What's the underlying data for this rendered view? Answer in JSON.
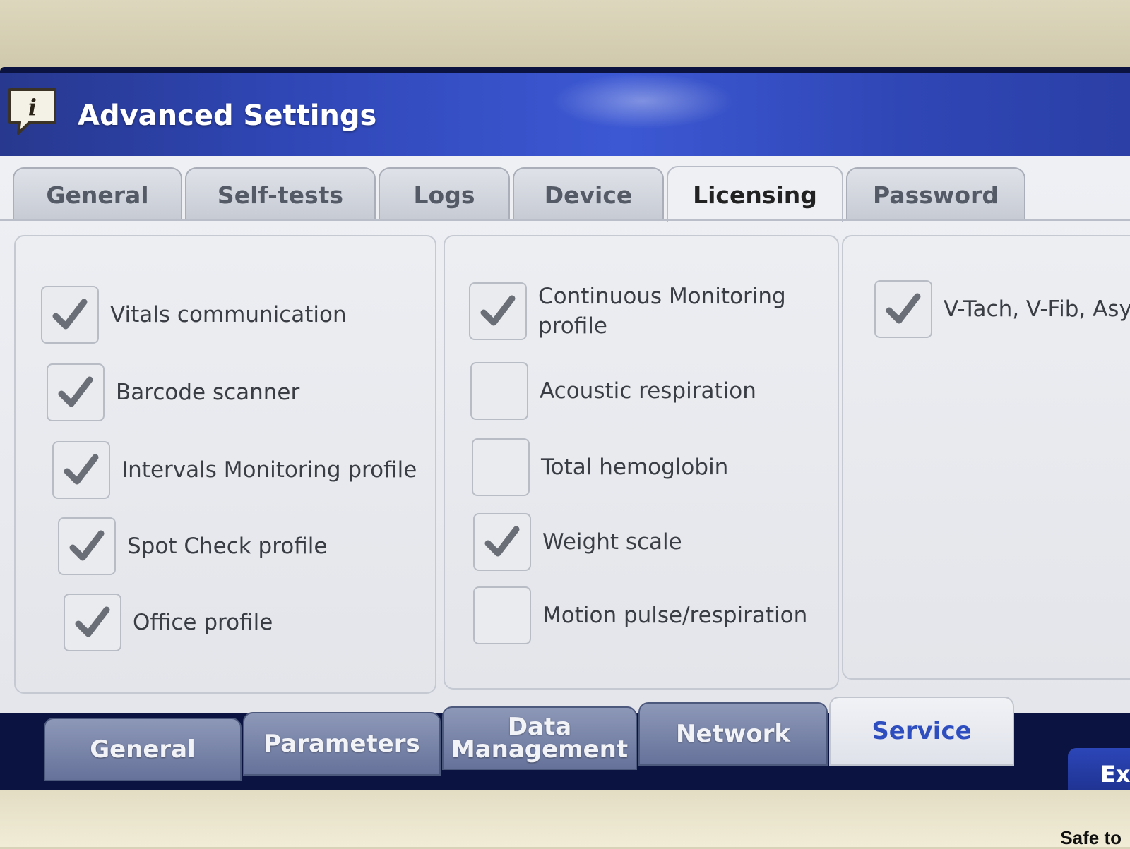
{
  "window": {
    "title": "Advanced Settings",
    "icon": "info-icon"
  },
  "top_tabs": [
    {
      "label": "General",
      "active": false
    },
    {
      "label": "Self-tests",
      "active": false
    },
    {
      "label": "Logs",
      "active": false
    },
    {
      "label": "Device",
      "active": false
    },
    {
      "label": "Licensing",
      "active": true
    },
    {
      "label": "Password",
      "active": false
    }
  ],
  "licensing": {
    "column1": [
      {
        "label": "Vitals communication",
        "checked": true
      },
      {
        "label": "Barcode scanner",
        "checked": true
      },
      {
        "label": "Intervals Monitoring profile",
        "checked": true
      },
      {
        "label": "Spot Check profile",
        "checked": true
      },
      {
        "label": "Office profile",
        "checked": true
      }
    ],
    "column2": [
      {
        "label_line1": "Continuous Monitoring",
        "label_line2": "profile",
        "checked": true
      },
      {
        "label": "Acoustic respiration",
        "checked": false
      },
      {
        "label": "Total hemoglobin",
        "checked": false
      },
      {
        "label": "Weight scale",
        "checked": true
      },
      {
        "label": "Motion pulse/respiration",
        "checked": false
      }
    ],
    "column3": [
      {
        "label": "V-Tach, V-Fib, Asyst",
        "checked": true
      }
    ]
  },
  "bottom_nav": [
    {
      "label": "General",
      "active": false
    },
    {
      "label": "Parameters",
      "active": false
    },
    {
      "label_line1": "Data",
      "label_line2": "Management",
      "active": false
    },
    {
      "label": "Network",
      "active": false
    },
    {
      "label": "Service",
      "active": true
    }
  ],
  "exit_button": {
    "label": "Ex"
  },
  "device_label": "Safe to",
  "colors": {
    "title_bar": "#2f46b5",
    "active_nav_text": "#2e4ec0",
    "checkmark": "#6a6e76"
  }
}
